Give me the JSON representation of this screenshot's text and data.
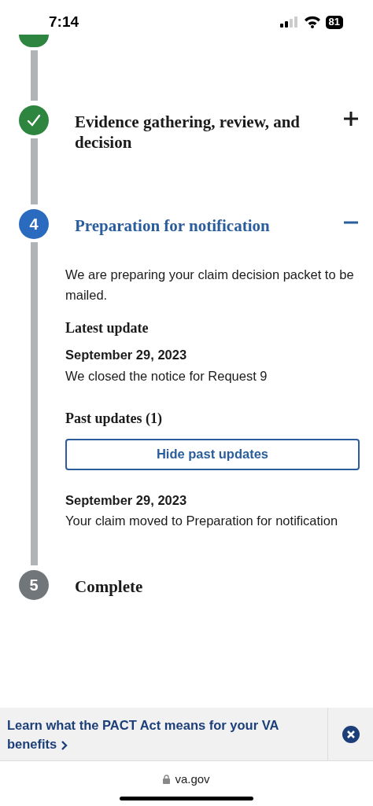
{
  "status_bar": {
    "time": "7:14",
    "battery": "81"
  },
  "steps": [
    {
      "kind": "complete",
      "cut": true
    },
    {
      "kind": "complete",
      "title": "Evidence gathering, review, and decision",
      "expanded": false
    },
    {
      "kind": "current",
      "number": "4",
      "title": "Preparation for notification",
      "expanded": true,
      "body": {
        "description": "We are preparing your claim decision packet to be mailed.",
        "latest_heading": "Latest update",
        "latest": {
          "date": "September 29, 2023",
          "text": "We closed the notice for Request 9"
        },
        "past_heading": "Past updates (1)",
        "toggle_button": "Hide past updates",
        "past_updates": [
          {
            "date": "September 29, 2023",
            "text": "Your claim moved to Preparation for notification"
          }
        ]
      }
    },
    {
      "kind": "upcoming",
      "number": "5",
      "title": "Complete"
    }
  ],
  "banner": {
    "link": "Learn what the PACT Act means for your VA benefits"
  },
  "address_bar": {
    "url": "va.gov"
  }
}
